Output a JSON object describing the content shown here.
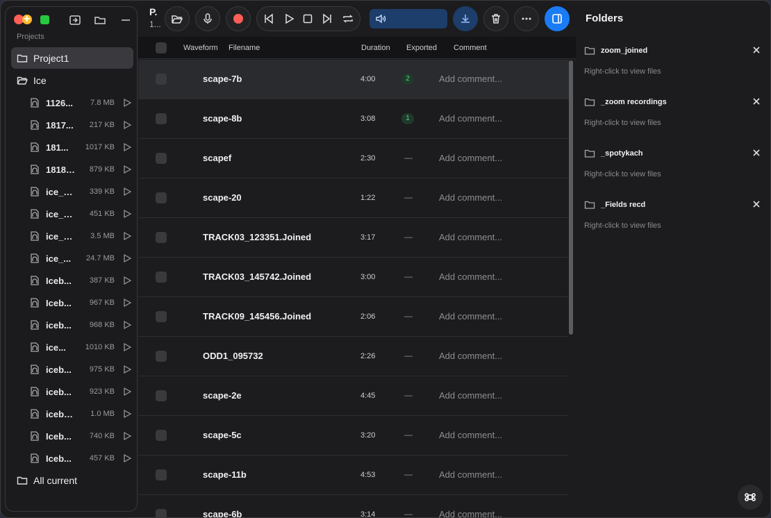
{
  "sidebar": {
    "section_label": "Projects",
    "projects": [
      {
        "label": "Project1",
        "active": true
      },
      {
        "label": "Ice",
        "active": false
      }
    ],
    "files": [
      {
        "name": "1126...",
        "size": "7.8 MB"
      },
      {
        "name": "1817...",
        "size": "217 KB"
      },
      {
        "name": "181...",
        "size": "1017 KB"
      },
      {
        "name": "18181...",
        "size": "879 KB"
      },
      {
        "name": "ice_b...",
        "size": "339 KB"
      },
      {
        "name": "ice_b...",
        "size": "451 KB"
      },
      {
        "name": "ice_b...",
        "size": "3.5 MB"
      },
      {
        "name": "ice_...",
        "size": "24.7 MB"
      },
      {
        "name": "Iceb...",
        "size": "387 KB"
      },
      {
        "name": "Iceb...",
        "size": "967 KB"
      },
      {
        "name": "iceb...",
        "size": "968 KB"
      },
      {
        "name": "ice...",
        "size": "1010 KB"
      },
      {
        "name": "iceb...",
        "size": "975 KB"
      },
      {
        "name": "iceb...",
        "size": "923 KB"
      },
      {
        "name": "icebo...",
        "size": "1.0 MB"
      },
      {
        "name": "Iceb...",
        "size": "740 KB"
      },
      {
        "name": "Iceb...",
        "size": "457 KB"
      }
    ],
    "footer_item": "All current"
  },
  "toolbar": {
    "project_title": "P.",
    "project_sub": "1..."
  },
  "table": {
    "headers": {
      "waveform": "Waveform",
      "filename": "Filename",
      "duration": "Duration",
      "exported": "Exported",
      "comment": "Comment"
    },
    "rows": [
      {
        "filename": "scape-7b",
        "duration": "4:00",
        "exported": "2",
        "comment": "Add comment...",
        "selected": true
      },
      {
        "filename": "scape-8b",
        "duration": "3:08",
        "exported": "1",
        "comment": "Add comment..."
      },
      {
        "filename": "scapef",
        "duration": "2:30",
        "exported": "—",
        "comment": "Add comment..."
      },
      {
        "filename": "scape-20",
        "duration": "1:22",
        "exported": "—",
        "comment": "Add comment..."
      },
      {
        "filename": "TRACK03_123351.Joined",
        "duration": "3:17",
        "exported": "—",
        "comment": "Add comment..."
      },
      {
        "filename": "TRACK03_145742.Joined",
        "duration": "3:00",
        "exported": "—",
        "comment": "Add comment..."
      },
      {
        "filename": "TRACK09_145456.Joined",
        "duration": "2:06",
        "exported": "—",
        "comment": "Add comment..."
      },
      {
        "filename": "ODD1_095732",
        "duration": "2:26",
        "exported": "—",
        "comment": "Add comment..."
      },
      {
        "filename": "scape-2e",
        "duration": "4:45",
        "exported": "—",
        "comment": "Add comment..."
      },
      {
        "filename": "scape-5c",
        "duration": "3:20",
        "exported": "—",
        "comment": "Add comment..."
      },
      {
        "filename": "scape-11b",
        "duration": "4:53",
        "exported": "—",
        "comment": "Add comment..."
      },
      {
        "filename": "scape-6b",
        "duration": "3:14",
        "exported": "—",
        "comment": "Add comment..."
      }
    ]
  },
  "folders_panel": {
    "title": "Folders",
    "hint": "Right-click to view files",
    "folders": [
      {
        "name": "zoom_joined"
      },
      {
        "name": "_zoom recordings"
      },
      {
        "name": "_spotykach"
      },
      {
        "name": "_Fields recd"
      }
    ]
  },
  "colors": {
    "accent_blue": "#1a7cf5",
    "record_red": "#ff5f57",
    "exported_badge": "#5fd08a"
  }
}
